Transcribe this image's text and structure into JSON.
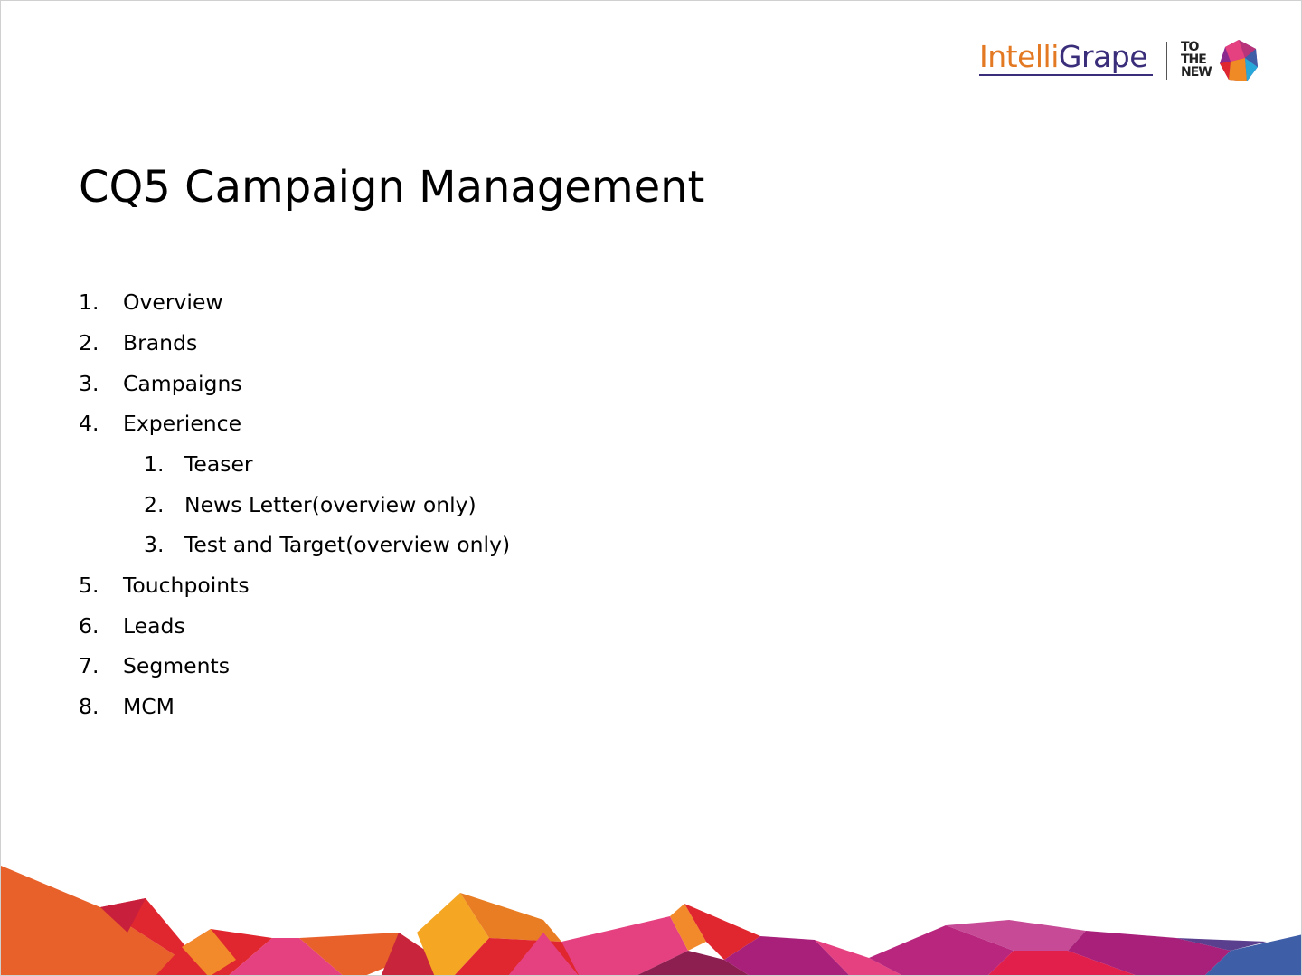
{
  "logo": {
    "part1": "Intelli",
    "part2": "Grape",
    "tagline_lines": [
      "TO",
      "THE",
      "NEW"
    ]
  },
  "title": "CQ5 Campaign Management",
  "items": [
    {
      "num": "1.",
      "text": "Overview"
    },
    {
      "num": "2.",
      "text": "Brands"
    },
    {
      "num": "3.",
      "text": "Campaigns"
    },
    {
      "num": "4.",
      "text": "Experience"
    },
    {
      "num": "1.",
      "text": "Teaser"
    },
    {
      "num": "2.",
      "text": "News Letter(overview only)"
    },
    {
      "num": "3.",
      "text": "Test and Target(overview only)"
    },
    {
      "num": "5.",
      "text": "Touchpoints"
    },
    {
      "num": "6.",
      "text": "Leads"
    },
    {
      "num": "7.",
      "text": "Segments"
    },
    {
      "num": "8.",
      "text": "MCM"
    }
  ],
  "colors": {
    "brand_orange": "#e37a23",
    "brand_purple": "#3a2e7a",
    "accent_red": "#e0262e",
    "accent_pink": "#e5407f",
    "accent_magenta": "#a8207a",
    "accent_blue": "#3f5ea8"
  }
}
